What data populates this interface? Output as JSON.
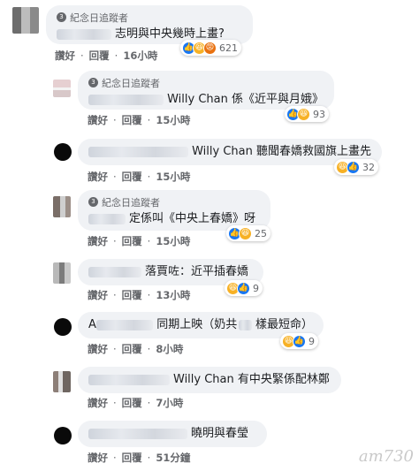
{
  "badge_label": "紀念日追蹤者",
  "actions": {
    "like": "讚好",
    "reply": "回覆",
    "separator": "·"
  },
  "comments": [
    {
      "text": "志明與中央幾時上畫?",
      "time": "16小時",
      "reaction_count": "621"
    },
    {
      "text": "Willy Chan 係《近平與月娥》",
      "time": "15小時",
      "reaction_count": "93"
    },
    {
      "text": "Willy Chan 聽聞春嬌救國旗上畫先",
      "time": "15小時",
      "reaction_count": "32"
    },
    {
      "text": "定係叫《中央上春嬌》呀",
      "time": "15小時",
      "reaction_count": "25"
    },
    {
      "text": "落賈咗：近平插春嬌",
      "time": "13小時",
      "reaction_count": "9"
    },
    {
      "prefix": "A",
      "text": "同期上映（奶共",
      "text2": "樣最短命）",
      "time": "8小時",
      "reaction_count": "9"
    },
    {
      "text": "Willy Chan 有中央緊係配林鄭",
      "time": "7小時"
    },
    {
      "text": "曉明與春瑩",
      "time": "51分鐘"
    }
  ],
  "watermark": "am730"
}
